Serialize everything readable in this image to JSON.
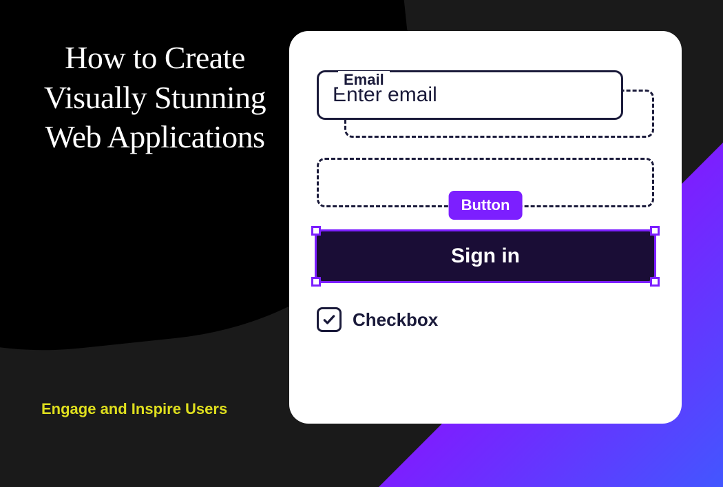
{
  "left": {
    "heading": "How to Create Visually Stunning Web Applications",
    "tagline": "Engage and Inspire Users"
  },
  "form": {
    "email_label": "Email",
    "email_placeholder": "Enter email",
    "button_tag": "Button",
    "signin_label": "Sign in",
    "checkbox_label": "Checkbox"
  }
}
